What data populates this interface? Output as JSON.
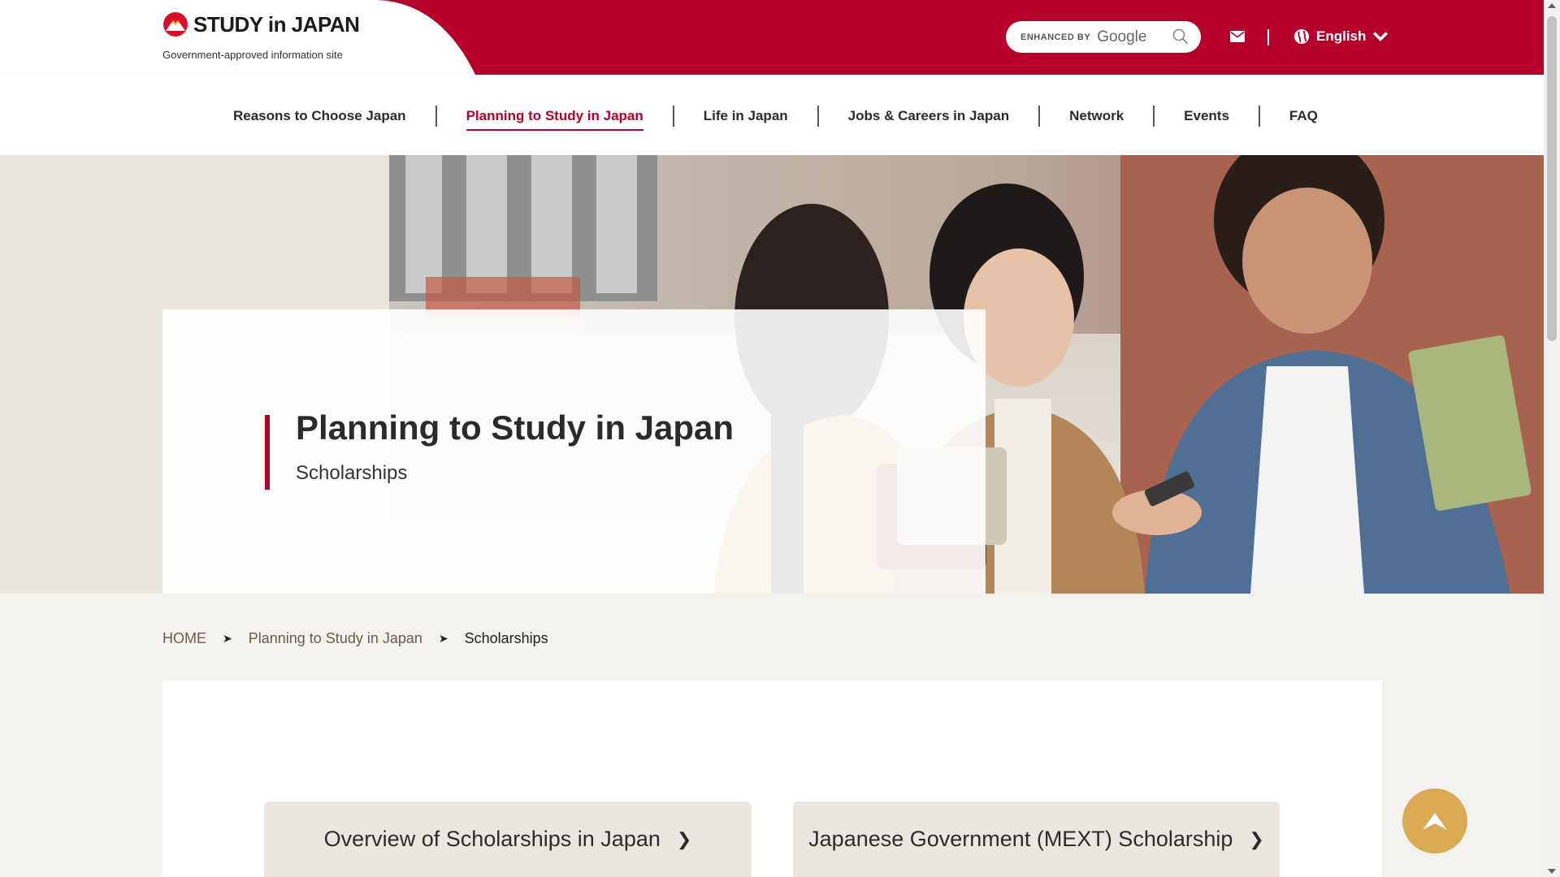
{
  "header": {
    "logo_text": "STUDY in JAPAN",
    "logo_subtitle": "Government-approved information site",
    "search": {
      "enhanced_by": "ENHANCED BY",
      "brand": "Google"
    },
    "language": "English",
    "icons": {
      "mail": "mail-icon",
      "globe": "globe-icon",
      "search": "search-icon"
    }
  },
  "nav": {
    "items": [
      {
        "label": "Reasons to Choose Japan",
        "active": false
      },
      {
        "label": "Planning to Study in Japan",
        "active": true
      },
      {
        "label": "Life in Japan",
        "active": false
      },
      {
        "label": "Jobs & Careers in Japan",
        "active": false
      },
      {
        "label": "Network",
        "active": false
      },
      {
        "label": "Events",
        "active": false
      },
      {
        "label": "FAQ",
        "active": false
      }
    ]
  },
  "hero": {
    "title": "Planning to Study in Japan",
    "subtitle": "Scholarships"
  },
  "breadcrumb": {
    "home": "HOME",
    "parent": "Planning to Study in Japan",
    "current": "Scholarships"
  },
  "cards": [
    {
      "label": "Overview of Scholarships in Japan"
    },
    {
      "label": "Japanese Government (MEXT) Scholarship"
    }
  ],
  "colors": {
    "brand_red": "#b5002c",
    "accent_gold": "#d9aa52",
    "card_bg": "#ebe7e0",
    "page_bg": "#f4f2ef"
  }
}
